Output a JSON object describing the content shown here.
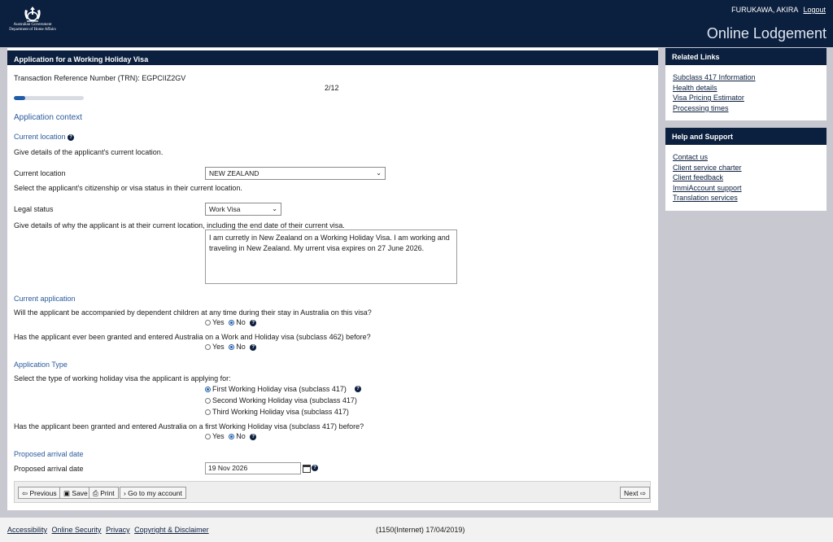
{
  "header": {
    "gov_line1": "Australian Government",
    "gov_line2": "Department of Home Affairs",
    "user_name": "FURUKAWA, AKIRA",
    "logout": "Logout",
    "site_title": "Online Lodgement"
  },
  "form": {
    "title": "Application for a Working Holiday Visa",
    "trn": "Transaction Reference Number (TRN): EGPCIIZ2GV",
    "page": "2/12",
    "progress_fraction": 0.167,
    "section_title": "Application context",
    "current_location_heading": "Current location",
    "current_location_desc": "Give details of the applicant's current location.",
    "current_location_label": "Current location",
    "current_location_value": "NEW ZEALAND",
    "citizenship_desc": "Select the applicant's citizenship or visa status in their current location.",
    "legal_status_label": "Legal status",
    "legal_status_value": "Work Visa",
    "reason_desc": "Give details of why the applicant is at their current location, including the end date of their current visa.",
    "reason_value": "I am curretly in New Zealand on a Working Holiday Visa. I am working and traveling in New Zealand. My urrent visa expires on 27 June 2026.",
    "current_application_heading": "Current application",
    "q_dependents": "Will the applicant be accompanied by dependent children at any time during their stay in Australia on this visa?",
    "q_462": "Has the applicant ever been granted and entered Australia on a Work and Holiday visa (subclass 462) before?",
    "yes": "Yes",
    "no": "No",
    "application_type_heading": "Application Type",
    "type_desc": "Select the type of working holiday visa the applicant is applying for:",
    "type_options": [
      "First Working Holiday visa (subclass 417)",
      "Second Working Holiday visa (subclass 417)",
      "Third Working Holiday visa (subclass 417)"
    ],
    "q_first_417": "Has the applicant been granted and entered Australia on a first Working Holiday visa (subclass 417) before?",
    "arrival_heading": "Proposed arrival date",
    "arrival_label": "Proposed arrival date",
    "arrival_value": "19 Nov 2026"
  },
  "buttons": {
    "previous": "Previous",
    "save": "Save",
    "print": "Print",
    "account": "Go to my account",
    "next": "Next"
  },
  "related_links": {
    "title": "Related Links",
    "items": [
      "Subclass 417 Information",
      "Health details",
      "Visa Pricing Estimator",
      "Processing times"
    ]
  },
  "help_support": {
    "title": "Help and Support",
    "items": [
      "Contact us",
      "Client service charter",
      "Client feedback",
      "ImmiAccount support",
      "Translation services"
    ]
  },
  "footer": {
    "links": [
      "Accessibility",
      "Online Security",
      "Privacy",
      "Copyright & Disclaimer"
    ],
    "version": "(1150(Internet) 17/04/2019)"
  },
  "colors": {
    "header_bg": "#0b1f3e",
    "accent": "#1f5da8",
    "section_heading": "#2a5a9c"
  }
}
